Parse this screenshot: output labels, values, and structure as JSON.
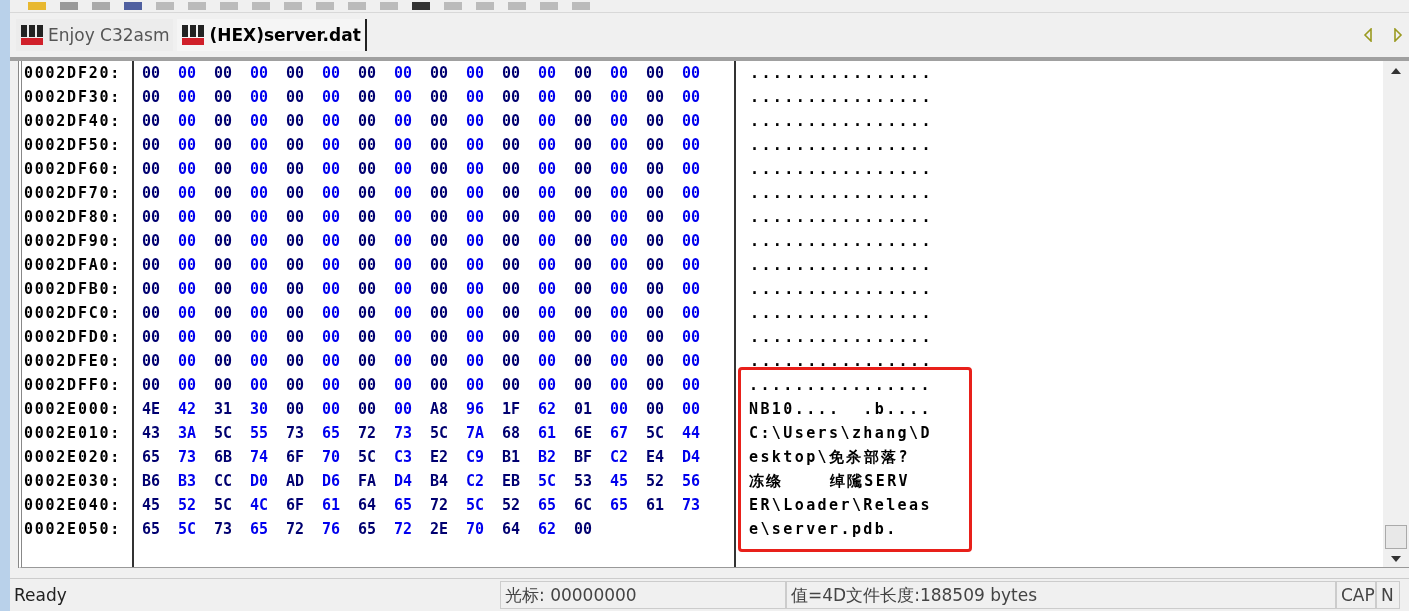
{
  "tabs": [
    {
      "label": "Enjoy C32asm",
      "selected": false
    },
    {
      "label": "(HEX)server.dat",
      "selected": true
    }
  ],
  "rows": [
    {
      "address": "0002DF20:",
      "bytes": [
        "00",
        "00",
        "00",
        "00",
        "00",
        "00",
        "00",
        "00",
        "00",
        "00",
        "00",
        "00",
        "00",
        "00",
        "00",
        "00"
      ],
      "ascii": "................"
    },
    {
      "address": "0002DF30:",
      "bytes": [
        "00",
        "00",
        "00",
        "00",
        "00",
        "00",
        "00",
        "00",
        "00",
        "00",
        "00",
        "00",
        "00",
        "00",
        "00",
        "00"
      ],
      "ascii": "................"
    },
    {
      "address": "0002DF40:",
      "bytes": [
        "00",
        "00",
        "00",
        "00",
        "00",
        "00",
        "00",
        "00",
        "00",
        "00",
        "00",
        "00",
        "00",
        "00",
        "00",
        "00"
      ],
      "ascii": "................"
    },
    {
      "address": "0002DF50:",
      "bytes": [
        "00",
        "00",
        "00",
        "00",
        "00",
        "00",
        "00",
        "00",
        "00",
        "00",
        "00",
        "00",
        "00",
        "00",
        "00",
        "00"
      ],
      "ascii": "................"
    },
    {
      "address": "0002DF60:",
      "bytes": [
        "00",
        "00",
        "00",
        "00",
        "00",
        "00",
        "00",
        "00",
        "00",
        "00",
        "00",
        "00",
        "00",
        "00",
        "00",
        "00"
      ],
      "ascii": "................"
    },
    {
      "address": "0002DF70:",
      "bytes": [
        "00",
        "00",
        "00",
        "00",
        "00",
        "00",
        "00",
        "00",
        "00",
        "00",
        "00",
        "00",
        "00",
        "00",
        "00",
        "00"
      ],
      "ascii": "................"
    },
    {
      "address": "0002DF80:",
      "bytes": [
        "00",
        "00",
        "00",
        "00",
        "00",
        "00",
        "00",
        "00",
        "00",
        "00",
        "00",
        "00",
        "00",
        "00",
        "00",
        "00"
      ],
      "ascii": "................"
    },
    {
      "address": "0002DF90:",
      "bytes": [
        "00",
        "00",
        "00",
        "00",
        "00",
        "00",
        "00",
        "00",
        "00",
        "00",
        "00",
        "00",
        "00",
        "00",
        "00",
        "00"
      ],
      "ascii": "................"
    },
    {
      "address": "0002DFA0:",
      "bytes": [
        "00",
        "00",
        "00",
        "00",
        "00",
        "00",
        "00",
        "00",
        "00",
        "00",
        "00",
        "00",
        "00",
        "00",
        "00",
        "00"
      ],
      "ascii": "................"
    },
    {
      "address": "0002DFB0:",
      "bytes": [
        "00",
        "00",
        "00",
        "00",
        "00",
        "00",
        "00",
        "00",
        "00",
        "00",
        "00",
        "00",
        "00",
        "00",
        "00",
        "00"
      ],
      "ascii": "................"
    },
    {
      "address": "0002DFC0:",
      "bytes": [
        "00",
        "00",
        "00",
        "00",
        "00",
        "00",
        "00",
        "00",
        "00",
        "00",
        "00",
        "00",
        "00",
        "00",
        "00",
        "00"
      ],
      "ascii": "................"
    },
    {
      "address": "0002DFD0:",
      "bytes": [
        "00",
        "00",
        "00",
        "00",
        "00",
        "00",
        "00",
        "00",
        "00",
        "00",
        "00",
        "00",
        "00",
        "00",
        "00",
        "00"
      ],
      "ascii": "................"
    },
    {
      "address": "0002DFE0:",
      "bytes": [
        "00",
        "00",
        "00",
        "00",
        "00",
        "00",
        "00",
        "00",
        "00",
        "00",
        "00",
        "00",
        "00",
        "00",
        "00",
        "00"
      ],
      "ascii": "................"
    }
  ],
  "highlighted_block": {
    "rows": [
      {
        "address": "0002DFF0:",
        "bytes": [
          "00",
          "00",
          "00",
          "00",
          "00",
          "00",
          "00",
          "00",
          "00",
          "00",
          "00",
          "00",
          "00",
          "00",
          "00",
          "00"
        ],
        "ascii": "................"
      },
      {
        "address": "0002E000:",
        "bytes": [
          "4E",
          "42",
          "31",
          "30",
          "00",
          "00",
          "00",
          "00",
          "A8",
          "96",
          "1F",
          "62",
          "01",
          "00",
          "00",
          "00"
        ],
        "ascii": "NB10....  .b...."
      },
      {
        "address": "0002E010:",
        "bytes": [
          "43",
          "3A",
          "5C",
          "55",
          "73",
          "65",
          "72",
          "73",
          "5C",
          "7A",
          "68",
          "61",
          "6E",
          "67",
          "5C",
          "44"
        ],
        "ascii": "C:\\Users\\zhang\\D"
      },
      {
        "address": "0002E020:",
        "bytes": [
          "65",
          "73",
          "6B",
          "74",
          "6F",
          "70",
          "5C",
          "C3",
          "E2",
          "C9",
          "B1",
          "B2",
          "BF",
          "C2",
          "E4",
          "D4"
        ],
        "ascii": "esktop\\免杀部落?"
      },
      {
        "address": "0002E030:",
        "bytes": [
          "B6",
          "B3",
          "CC",
          "D0",
          "AD",
          "D6",
          "FA",
          "D4",
          "B4",
          "C2",
          "EB",
          "5C",
          "53",
          "45",
          "52",
          "56"
        ],
        "ascii": "冻绦    绰隲SERV"
      },
      {
        "address": "0002E040:",
        "bytes": [
          "45",
          "52",
          "5C",
          "4C",
          "6F",
          "61",
          "64",
          "65",
          "72",
          "5C",
          "52",
          "65",
          "6C",
          "65",
          "61",
          "73"
        ],
        "ascii": "ER\\Loader\\Releas"
      },
      {
        "address": "0002E050:",
        "bytes": [
          "65",
          "5C",
          "73",
          "65",
          "72",
          "76",
          "65",
          "72",
          "2E",
          "70",
          "64",
          "62",
          "00"
        ],
        "ascii": "e\\server.pdb."
      }
    ]
  },
  "status_bar": {
    "message": "Ready",
    "cursor": "光标: 00000000",
    "value": "值=4D文件长度:188509 bytes",
    "caps": "CAP",
    "num": "N"
  }
}
